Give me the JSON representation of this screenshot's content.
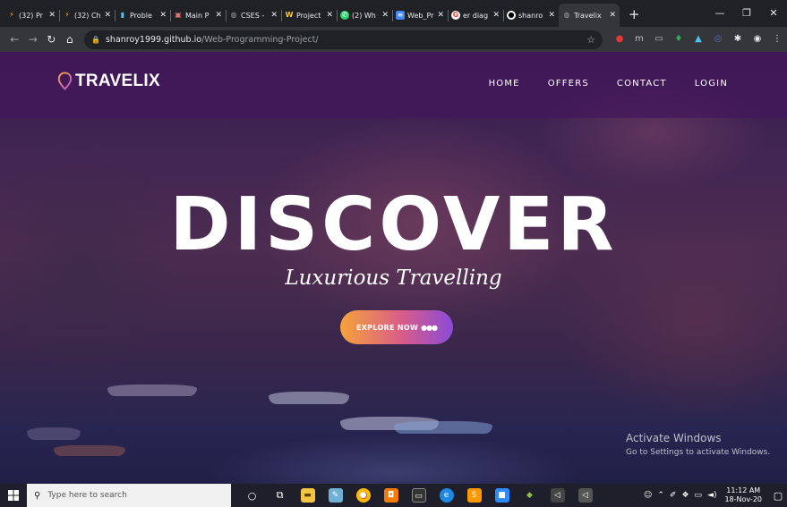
{
  "browser": {
    "tabs": [
      {
        "label": "(32) Pr",
        "icon": "codechef-icon",
        "color": "#f9a825"
      },
      {
        "label": "(32) Ch",
        "icon": "codechef-icon",
        "color": "#f9a825"
      },
      {
        "label": "Proble",
        "icon": "chart-bars-icon",
        "color": "#4fc3f7"
      },
      {
        "label": "Main P",
        "icon": "app-icon",
        "color": "#e57373"
      },
      {
        "label": "CSES -",
        "icon": "globe-icon",
        "color": "#9e9e9e"
      },
      {
        "label": "Project",
        "icon": "w-icon",
        "color": "#ffca28"
      },
      {
        "label": "(2) Wh",
        "icon": "whatsapp-icon",
        "color": "#25d366"
      },
      {
        "label": "Web_Pr",
        "icon": "docs-icon",
        "color": "#4285f4"
      },
      {
        "label": "er diag",
        "icon": "google-icon",
        "color": "#ea4335"
      },
      {
        "label": "shanro",
        "icon": "github-icon",
        "color": "#ffffff"
      },
      {
        "label": "Travelix",
        "icon": "globe-icon",
        "color": "#9e9e9e",
        "active": true
      }
    ],
    "url_host": "shanroy1999.github.io",
    "url_path": "/Web-Programming-Project/"
  },
  "site": {
    "logo": "TRAVELIX",
    "menu": [
      "HOME",
      "OFFERS",
      "CONTACT",
      "LOGIN"
    ],
    "headline": "DISCOVER",
    "tagline": "Luxurious Travelling",
    "cta": "EXPLORE NOW",
    "cta_dots": "●●●"
  },
  "watermark": {
    "title": "Activate Windows",
    "subtitle": "Go to Settings to activate Windows."
  },
  "taskbar": {
    "search_placeholder": "Type here to search",
    "time": "11:12 AM",
    "date": "18-Nov-20"
  },
  "colors": {
    "accent_orange": "#f7a33a",
    "accent_purple": "#8a4bd8",
    "nav_overlay": "#44165c"
  }
}
